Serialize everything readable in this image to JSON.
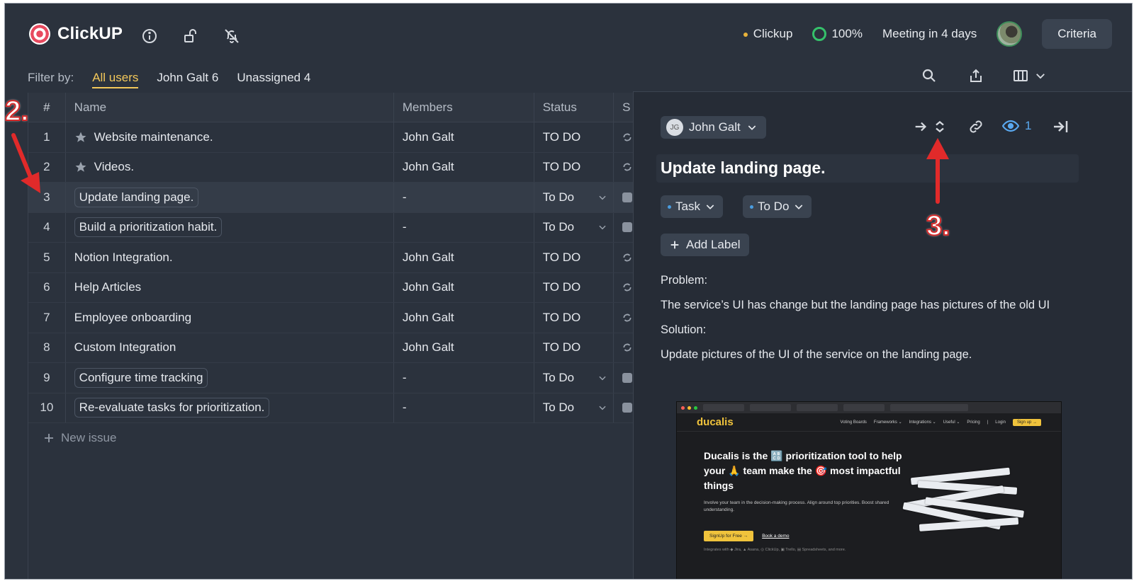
{
  "app": {
    "name": "ClickUP"
  },
  "header": {
    "workspace": "Clickup",
    "progress": "100%",
    "progress_value": 100,
    "meeting": "Meeting in 4 days",
    "criteria_label": "Criteria"
  },
  "filter": {
    "label": "Filter by:",
    "options": [
      "All users",
      "John Galt 6",
      "Unassigned 4"
    ],
    "active": "All users"
  },
  "table": {
    "columns": [
      "#",
      "Name",
      "Members",
      "Status",
      "S"
    ],
    "rows": [
      {
        "num": "1",
        "name": "Website maintenance.",
        "members": "John Galt",
        "status": "TO DO",
        "starred": true,
        "pill": false
      },
      {
        "num": "2",
        "name": "Videos.",
        "members": "John Galt",
        "status": "TO DO",
        "starred": true,
        "pill": false
      },
      {
        "num": "3",
        "name": "Update landing page.",
        "members": "-",
        "status": "To Do",
        "starred": false,
        "pill": true,
        "selected": true
      },
      {
        "num": "4",
        "name": "Build a prioritization habit.",
        "members": "-",
        "status": "To Do",
        "starred": false,
        "pill": true
      },
      {
        "num": "5",
        "name": "Notion Integration.",
        "members": "John Galt",
        "status": "TO DO",
        "starred": false,
        "pill": false
      },
      {
        "num": "6",
        "name": "Help Articles",
        "members": "John Galt",
        "status": "TO DO",
        "starred": false,
        "pill": false
      },
      {
        "num": "7",
        "name": "Employee onboarding",
        "members": "John Galt",
        "status": "TO DO",
        "starred": false,
        "pill": false
      },
      {
        "num": "8",
        "name": "Custom Integration",
        "members": "John Galt",
        "status": "TO DO",
        "starred": false,
        "pill": false
      },
      {
        "num": "9",
        "name": "Configure time tracking",
        "members": "-",
        "status": "To Do",
        "starred": false,
        "pill": true
      },
      {
        "num": "10",
        "name": "Re-evaluate tasks for prioritization.",
        "members": "-",
        "status": "To Do",
        "starred": false,
        "pill": true
      }
    ],
    "new_issue": "New issue"
  },
  "panel": {
    "assignee_initials": "JG",
    "assignee": "John Galt",
    "watchers": "1",
    "title": "Update landing page.",
    "type": "Task",
    "status": "To Do",
    "add_label": "Add Label",
    "description": {
      "problem_heading": "Problem:",
      "problem_text": "The service’s UI has change but the landing page has pictures of the old UI",
      "solution_heading": "Solution:",
      "solution_text": "Update pictures of the UI of the service on the landing page."
    },
    "screenshot": {
      "brand": "ducalis",
      "nav": [
        "Voting Boards",
        "Frameworks ⌄",
        "Integrations ⌄",
        "Useful ⌄",
        "Pricing",
        "|",
        "Login"
      ],
      "signup": "Sign up →",
      "headline": "Ducalis is the 🔠 prioritization tool to help your 🙏 team make the 🎯 most impactful things",
      "subtext": "Involve your team in the decision-making process. Align around top priorities. Boost shared understanding.",
      "cta_primary": "SignUp for Free →",
      "cta_secondary": "Book a demo",
      "integrations": "Integrates with ◆ Jira, ▲ Asana, ◎ ClickUp, ▣ Trello, ▤ Spreadsheets, and more."
    }
  },
  "annotations": {
    "step2": "2.",
    "step3": "3."
  },
  "colors": {
    "accent_filter": "#f3c85a",
    "progress_ring": "#35c26b",
    "link_blue": "#5aa9f0",
    "annotation_red": "#d42a2a"
  },
  "icons": [
    "info-icon",
    "unlock-icon",
    "bell-off-icon",
    "search-icon",
    "share-icon",
    "columns-icon",
    "chevron-down-icon",
    "star-icon",
    "plus-icon",
    "arrow-right-icon",
    "expand-collapse-icon",
    "link-icon",
    "eye-icon",
    "collapse-panel-icon"
  ]
}
